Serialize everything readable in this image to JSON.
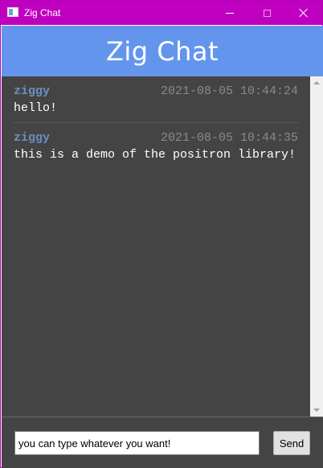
{
  "window": {
    "title": "Zig Chat",
    "icons": {
      "app": "app-window-icon",
      "minimize": "minimize-icon",
      "maximize": "maximize-icon",
      "close": "close-icon"
    }
  },
  "header": {
    "title": "Zig Chat"
  },
  "messages": [
    {
      "author": "ziggy",
      "timestamp": "2021-08-05 10:44:24",
      "text": "hello!"
    },
    {
      "author": "ziggy",
      "timestamp": "2021-08-05 10:44:35",
      "text": "this is a demo of the positron library!"
    }
  ],
  "composer": {
    "value": "you can type whatever you want!",
    "send_label": "Send"
  },
  "colors": {
    "titlebar": "#c000c0",
    "header": "#6495ed",
    "chat_background": "#444444",
    "author": "#6a8fc2",
    "timestamp": "#8a8a8a"
  }
}
